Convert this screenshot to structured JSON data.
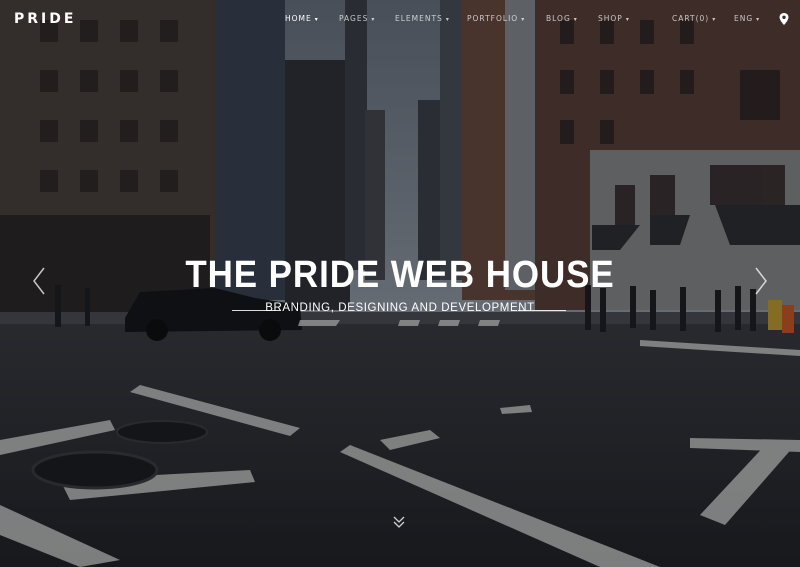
{
  "brand": {
    "logo": "PRIDE"
  },
  "nav": {
    "items": [
      {
        "label": "HOME",
        "has_caret": true,
        "active": true
      },
      {
        "label": "PAGES",
        "has_caret": true,
        "active": false
      },
      {
        "label": "ELEMENTS",
        "has_caret": true,
        "active": false
      },
      {
        "label": "PORTFOLIO",
        "has_caret": true,
        "active": false
      },
      {
        "label": "BLOG",
        "has_caret": true,
        "active": false
      },
      {
        "label": "SHOP",
        "has_caret": true,
        "active": false
      },
      {
        "label": "CART(0)",
        "has_caret": true,
        "active": false
      },
      {
        "label": "ENG",
        "has_caret": true,
        "active": false
      }
    ],
    "location_icon": "map-pin-icon",
    "caret_glyph": "▾"
  },
  "hero": {
    "title": "THE PRIDE WEB HOUSE",
    "subtitle": "BRANDING, DESIGNING AND DEVELOPMENT",
    "prev_icon": "chevron-left-icon",
    "next_icon": "chevron-right-icon",
    "scroll_icon": "double-chevron-down-icon"
  },
  "colors": {
    "text": "#ffffff",
    "sky": "#5d6672",
    "road": "#2c2d31",
    "overlay": "rgba(10,12,16,0.35)"
  }
}
